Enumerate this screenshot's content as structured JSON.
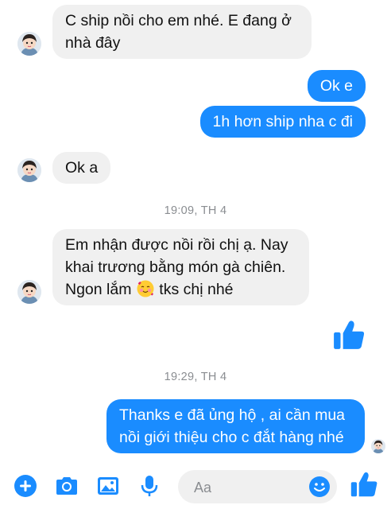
{
  "messages": [
    {
      "from": "them",
      "text": "C ship nồi cho em nhé. E đang ở nhà đây"
    },
    {
      "from": "me",
      "text": "Ok e"
    },
    {
      "from": "me",
      "text": "1h hơn ship nha c đi"
    },
    {
      "from": "them",
      "text": "Ok a"
    },
    {
      "from": "them",
      "text_before": "Em nhận được nồi rồi chị ạ. Nay khai trương bằng món gà chiên. Ngon lắm",
      "emoji": "smiling-face-with-hearts",
      "text_after": " tks chị nhé"
    },
    {
      "from": "me",
      "type": "like"
    },
    {
      "from": "me",
      "text": "Thanks e đã ủng hộ , ai cần mua nồi giới thiệu cho c đắt hàng nhé"
    }
  ],
  "timestamps": [
    "19:09, TH 4",
    "19:29, TH 4"
  ],
  "composer": {
    "placeholder": "Aa",
    "tools": [
      "plus-icon",
      "camera-icon",
      "photo-icon",
      "microphone-icon"
    ],
    "emoji_icon": "smiley-icon",
    "send_icon": "like-icon"
  },
  "colors": {
    "outgoing_bubble": "#1a8cff",
    "incoming_bubble": "#f0f0f0",
    "accent": "#1a8cff",
    "timestamp_text": "#8a8d91"
  }
}
